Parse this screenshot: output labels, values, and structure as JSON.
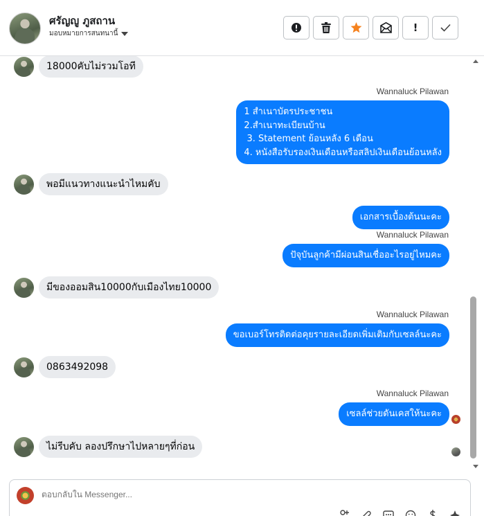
{
  "header": {
    "contact_name": "ศรัญญู ภูสถาน",
    "assign_label": "มอบหมายการสนทนานี้",
    "toolbar": [
      {
        "name": "spam-button",
        "icon": "alert-circle-icon"
      },
      {
        "name": "delete-button",
        "icon": "trash-icon"
      },
      {
        "name": "star-button",
        "icon": "star-icon",
        "color": "#f5821f"
      },
      {
        "name": "mark-unread-button",
        "icon": "envelope-icon"
      },
      {
        "name": "follow-up-button",
        "icon": "exclamation-icon",
        "label": "!"
      },
      {
        "name": "mark-done-button",
        "icon": "checkmark-icon"
      }
    ]
  },
  "messages": {
    "m1": "18000คับไม่รวมโอที",
    "sender": "Wannaluck Pilawan",
    "m2": "1 สำเนาบัตรประชาชน\n2.สำเนาทะเบียนบ้าน\n 3. Statement ย้อนหลัง 6 เดือน\n4. หนังสือรับรองเงินเดือนหรือสลิปเงินเดือนย้อนหลัง",
    "m3": "พอมีแนวทางแนะนำไหมคับ",
    "m4": "เอกสารเบื้องต้นนะคะ",
    "m5": "ปัจุบันลูกค้ามีผ่อนสินเชื่ออะไรอยู่ไหมคะ",
    "m6": "มีของออมสิน10000กับเมืองไทย10000",
    "m7": "ขอเบอร์โทรติดต่อคุยรายละเอียดเพิ่มเติมกับเซลล์นะคะ",
    "m8": "0863492098",
    "m9": "เซลล์ช่วยดันเคสให้นะคะ",
    "m10": "ไม่รีบคับ ลองปรึกษาไปหลายๆที่ก่อน"
  },
  "composer": {
    "placeholder": "ตอบกลับใน Messenger..."
  },
  "colors": {
    "outgoing_bubble": "#0a7cff",
    "incoming_bubble": "#e9ebee",
    "star": "#f5821f"
  }
}
